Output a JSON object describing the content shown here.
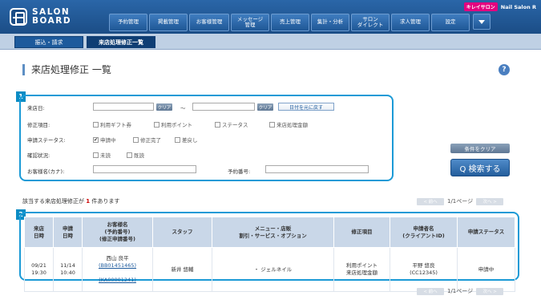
{
  "app": {
    "logo_line1": "SALON",
    "logo_line2": "BOARD"
  },
  "shop": {
    "badge": "キレイサロン",
    "name": "Nail Salon R"
  },
  "nav": {
    "items": [
      "予約管理",
      "掲載管理",
      "お客様管理",
      "メッセージ\n管理",
      "売上管理",
      "集計・分析",
      "サロン\nダイレクト",
      "求人管理",
      "設定"
    ]
  },
  "subnav": {
    "items": [
      "振込・請求",
      "来店処理修正一覧"
    ]
  },
  "page": {
    "title": "来店処理修正 一覧",
    "help": "?"
  },
  "callouts": [
    "1",
    "2"
  ],
  "search": {
    "visit_date_label": "来店日:",
    "clear_small": "クリア",
    "tilde": "〜",
    "reset_date": "日付を元に戻す",
    "correction_label": "修正項目:",
    "correction_options": [
      {
        "label": "利用ギフト券",
        "checked": false
      },
      {
        "label": "利用ポイント",
        "checked": false
      },
      {
        "label": "ステータス",
        "checked": false
      },
      {
        "label": "来店処理金額",
        "checked": false
      }
    ],
    "status_label": "申請ステータス:",
    "status_options": [
      {
        "label": "申請中",
        "checked": true
      },
      {
        "label": "修正完了",
        "checked": false
      },
      {
        "label": "差戻し",
        "checked": false
      }
    ],
    "confirm_label": "確認状況:",
    "confirm_options": [
      {
        "label": "未読",
        "checked": false
      },
      {
        "label": "既読",
        "checked": false
      }
    ],
    "customer_label": "お客様名(カナ):",
    "booking_label": "予約番号:",
    "clear_conditions": "条件をクリア",
    "search_button": "Q 検索する"
  },
  "results": {
    "prefix": "該当する来店処理修正が",
    "count": "1",
    "suffix": "件あります"
  },
  "pager": {
    "prev": "< 前へ",
    "page": "1/1ページ",
    "next": "次へ >"
  },
  "table": {
    "headers": [
      "来店\n日時",
      "申請\n日時",
      "お客様名\n(予約番号)\n(修正申請番号)",
      "スタッフ",
      "メニュー・店販\n割引・サービス・オプション",
      "修正項目",
      "申請者名\n(クライアントID)",
      "申請ステータス"
    ],
    "rows": [
      {
        "visit": "09/21\n19:30",
        "applied": "11/14\n10:40",
        "customer": "西山 良平",
        "booking_no": "(BB01451465)",
        "correction_no": "(KA00001241)",
        "staff": "新井 悠輔",
        "menu": "・ ジェルネイル",
        "item": "利用ポイント\n来店処理金額",
        "applicant": "平野 悠良\n(CC12345)",
        "status": "申請中"
      }
    ]
  }
}
